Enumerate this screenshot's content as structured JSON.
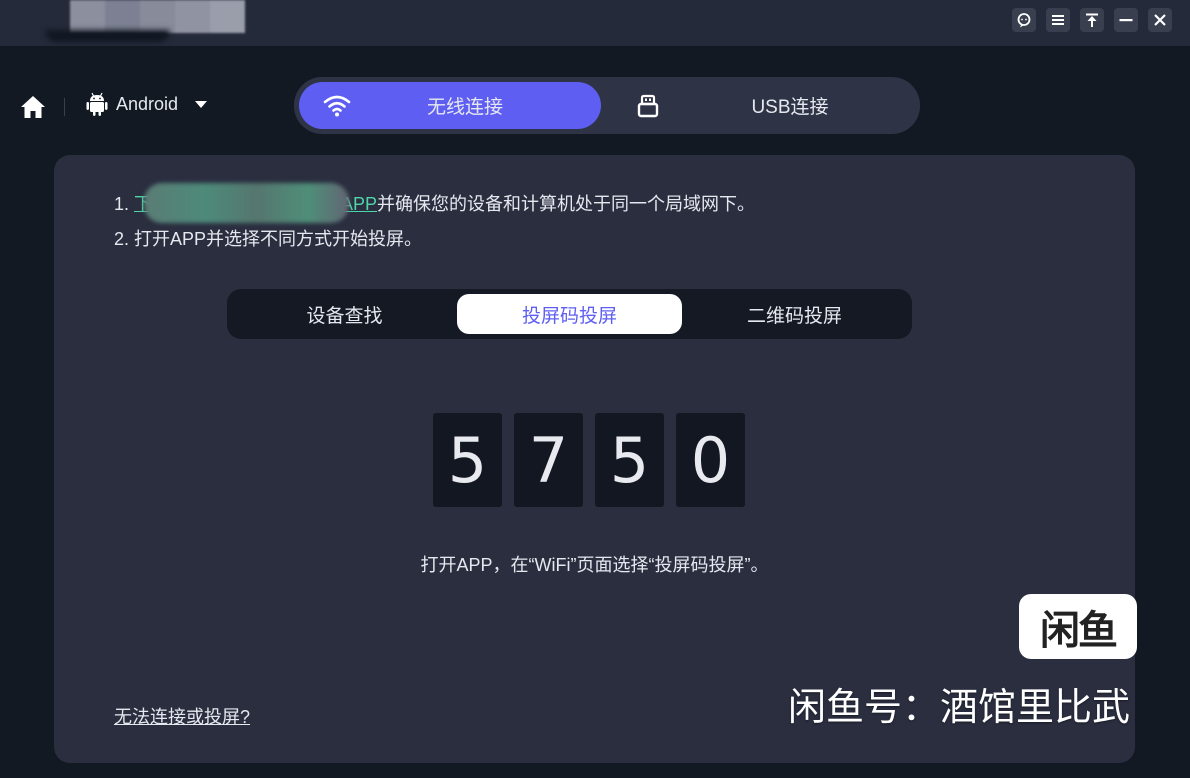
{
  "titlebar": {
    "buttons": [
      {
        "name": "feedback-icon"
      },
      {
        "name": "menu-icon"
      },
      {
        "name": "pin-top-icon"
      },
      {
        "name": "minimize-icon"
      },
      {
        "name": "close-icon"
      }
    ]
  },
  "nav": {
    "os_label": "Android"
  },
  "connection_mode": {
    "wireless_label": "无线连接",
    "usb_label": "USB连接",
    "active": "wireless",
    "accent_color": "#5e5ff2"
  },
  "instructions": {
    "step1_prefix": "1. ",
    "step1_link_start": "下",
    "step1_link_end": "APP",
    "step1_rest": "并确保您的设备和计算机处于同一个局域网下。",
    "step2": "2. 打开APP并选择不同方式开始投屏。"
  },
  "method_tabs": {
    "items": [
      "设备查找",
      "投屏码投屏",
      "二维码投屏"
    ],
    "selected": "投屏码投屏"
  },
  "cast_code": [
    "5",
    "7",
    "5",
    "0"
  ],
  "hint": "打开APP，在“WiFi”页面选择“投屏码投屏”。",
  "help_link": "无法连接或投屏?",
  "overlay": {
    "logo_text": "闲鱼",
    "watermark": "闲鱼号：酒馆里比武"
  }
}
